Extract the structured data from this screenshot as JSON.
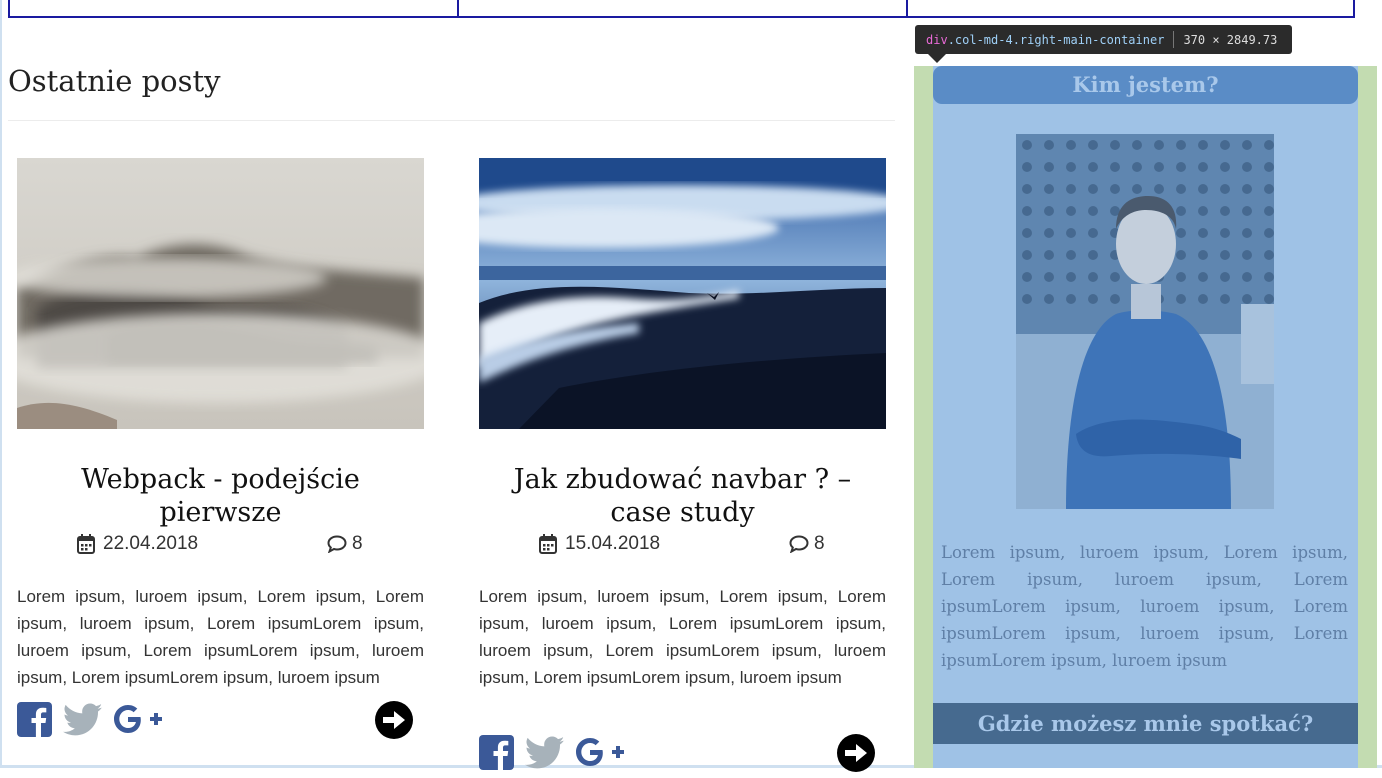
{
  "section": {
    "title": "Ostatnie posty"
  },
  "posts": [
    {
      "title": "Webpack - podejście pierwsze",
      "date": "22.04.2018",
      "comments": "8",
      "excerpt": "Lorem ipsum, luroem ipsum, Lorem ipsum, Lorem ipsum, luroem ipsum, Lorem ipsumLorem ipsum, luroem ipsum, Lorem ipsumLorem ipsum, luroem ipsum, Lorem ipsumLorem ipsum, luroem ipsum",
      "image_icon": "foggy-mountain-image"
    },
    {
      "title": "Jak zbudować navbar ? – case study",
      "date": "15.04.2018",
      "comments": "8",
      "excerpt": "Lorem ipsum, luroem ipsum, Lorem ipsum, Lorem ipsum, luroem ipsum, Lorem ipsumLorem ipsum, luroem ipsum, Lorem ipsumLorem ipsum, luroem ipsum, Lorem ipsumLorem ipsum, luroem ipsum",
      "image_icon": "beach-waves-image"
    }
  ],
  "sidebar": {
    "about_title": "Kim jestem?",
    "bio": "Lorem ipsum, luroem ipsum, Lorem ipsum, Lorem ipsum, luroem ipsum, Lorem ipsumLorem ipsum, luroem ipsum, Lorem ipsumLorem ipsum, luroem ipsum, Lorem ipsumLorem ipsum, luroem ipsum",
    "meet_title": "Gdzie możesz mnie spotkać?",
    "photo_icon": "author-photo"
  },
  "devtools_tooltip": {
    "tag": "div",
    "classes": ".col-md-4.right-main-container",
    "size": "370 × 2849.73"
  },
  "colors": {
    "facebook": "#3b5998",
    "twitter": "#a7b2ba",
    "google_plus": "#3b5998",
    "sidebar_green": "#c3dcb1",
    "sidebar_blue": "#9fc2e6",
    "header_blue": "#5a8cc6"
  }
}
